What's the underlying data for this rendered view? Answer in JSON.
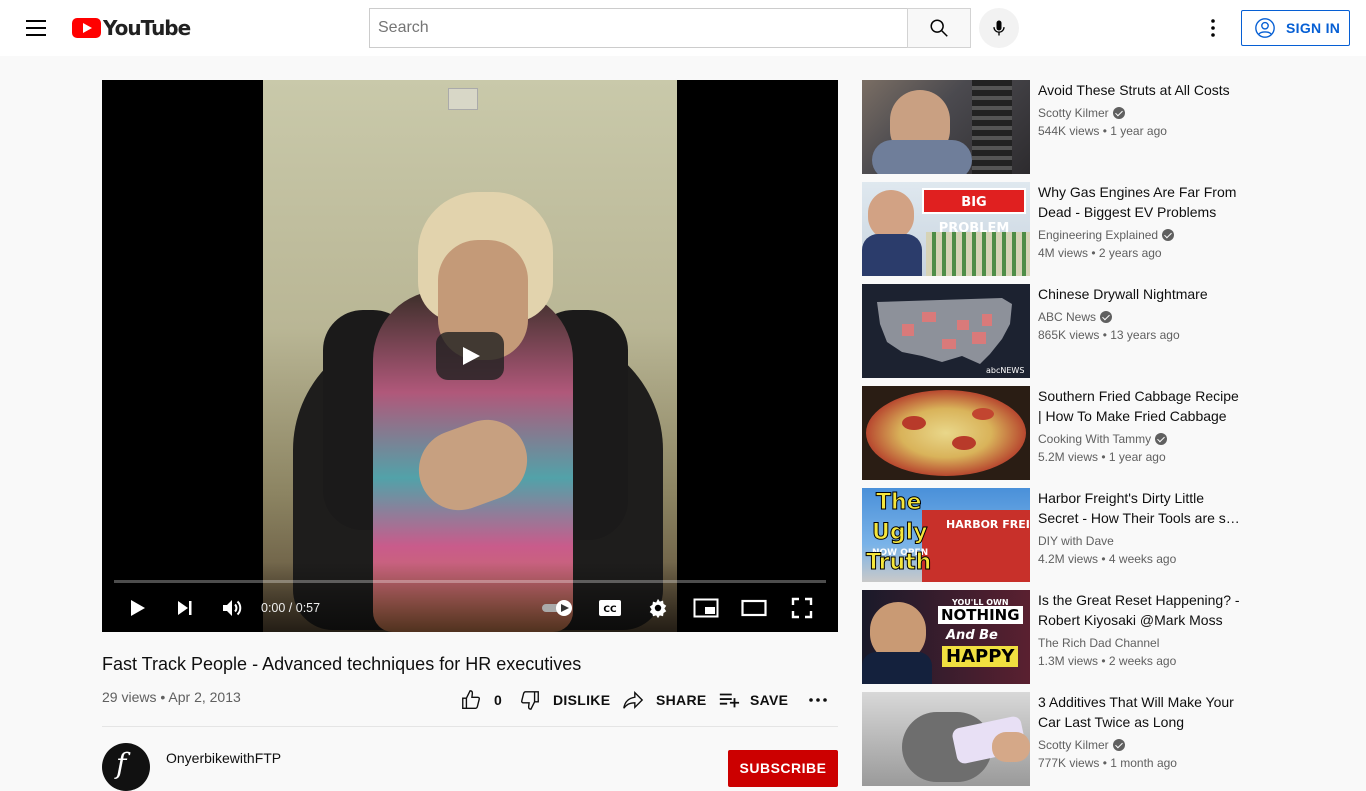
{
  "header": {
    "logo_text": "YouTube",
    "search_placeholder": "Search",
    "signin_label": "SIGN IN"
  },
  "player": {
    "time": "0:00 / 0:57",
    "progress": 0
  },
  "video": {
    "title": "Fast Track People - Advanced techniques for HR executives",
    "views": "29 views",
    "date": "Apr 2, 2013",
    "likes": "0",
    "dislike_label": "DISLIKE",
    "share_label": "SHARE",
    "save_label": "SAVE",
    "channel_name": "OnyerbikewithFTP",
    "subscribe_label": "SUBSCRIBE"
  },
  "recommendations": [
    {
      "title": "Avoid These Struts at All Costs",
      "channel": "Scotty Kilmer",
      "verified": true,
      "views": "544K views",
      "age": "1 year ago"
    },
    {
      "title": "Why Gas Engines Are Far From Dead - Biggest EV Problems",
      "channel": "Engineering Explained",
      "verified": true,
      "views": "4M views",
      "age": "2 years ago",
      "thumb_text": "BIG PROBLEM"
    },
    {
      "title": "Chinese Drywall Nightmare",
      "channel": "ABC News",
      "verified": true,
      "views": "865K views",
      "age": "13 years ago",
      "thumb_text": "abcNEWS"
    },
    {
      "title": "Southern Fried Cabbage Recipe | How To Make Fried Cabbage",
      "channel": "Cooking With Tammy",
      "verified": true,
      "views": "5.2M views",
      "age": "1 year ago"
    },
    {
      "title": "Harbor Freight's Dirty Little Secret - How Their Tools are s…",
      "channel": "DIY with Dave",
      "verified": false,
      "views": "4.2M views",
      "age": "4 weeks ago",
      "thumb_text_1": "The",
      "thumb_text_2": "Ugly",
      "thumb_text_3": "Truth",
      "thumb_text_4": "HARBOR FREIGHT",
      "thumb_text_5": "NOW OPEN"
    },
    {
      "title": "Is the Great Reset Happening? - Robert Kiyosaki @Mark Moss",
      "channel": "The Rich Dad Channel",
      "verified": false,
      "views": "1.3M views",
      "age": "2 weeks ago",
      "thumb_text_1": "YOU'LL OWN",
      "thumb_text_2": "NOTHING",
      "thumb_text_3": "And Be",
      "thumb_text_4": "HAPPY"
    },
    {
      "title": "3 Additives That Will Make Your Car Last Twice as Long",
      "channel": "Scotty Kilmer",
      "verified": true,
      "views": "777K views",
      "age": "1 month ago"
    }
  ]
}
